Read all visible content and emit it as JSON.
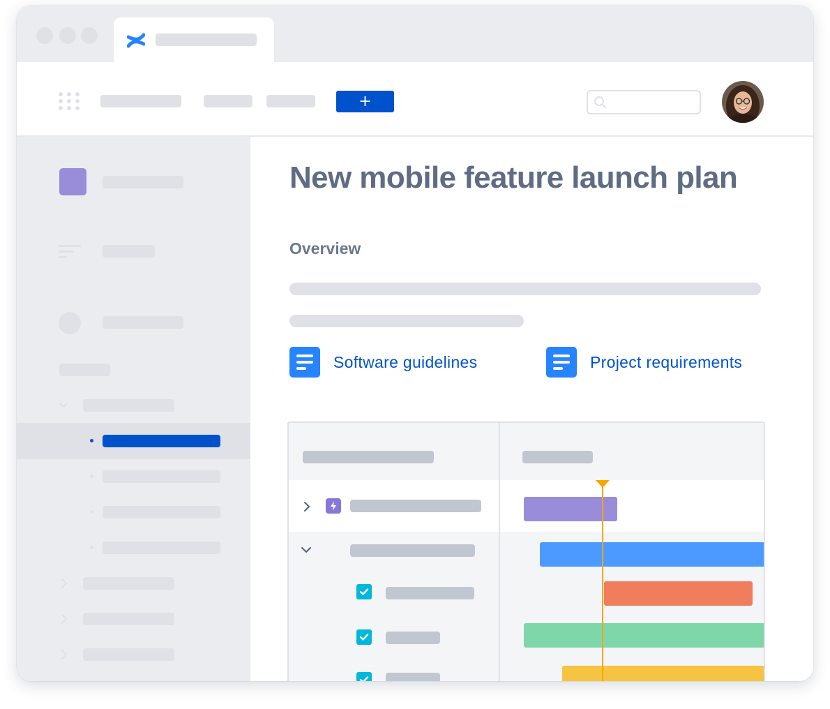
{
  "page": {
    "title": "New mobile feature launch plan",
    "overview_heading": "Overview"
  },
  "links": [
    {
      "label": "Software guidelines",
      "icon": "document-icon"
    },
    {
      "label": "Project requirements",
      "icon": "document-icon"
    }
  ],
  "toolbar": {
    "create_label": "+",
    "search_icon": "search-icon",
    "app_switcher_icon": "grid-icon"
  },
  "browser": {
    "tab_icon": "confluence-logo"
  },
  "colors": {
    "brand_blue": "#0052cc",
    "title_text": "#5e6c84",
    "purple": "#998dd9",
    "blue": "#4c9aff",
    "red": "#f07d5c",
    "green": "#7fd6a8",
    "yellow": "#f6c342",
    "today_marker": "#f8a600",
    "task_teal": "#00b8d9",
    "epic_purple": "#8777d9"
  },
  "timeline": {
    "rows": [
      {
        "type": "epic",
        "icon": "lightning-icon",
        "expanded": false,
        "bar_color": "purple"
      },
      {
        "type": "group",
        "expanded": true,
        "bar_color": "blue"
      },
      {
        "type": "task",
        "icon": "checkbox-checked-icon",
        "bar_color": "red"
      },
      {
        "type": "task",
        "icon": "checkbox-checked-icon",
        "bar_color": "green"
      },
      {
        "type": "task",
        "icon": "checkbox-checked-icon",
        "bar_color": "yellow"
      }
    ]
  }
}
